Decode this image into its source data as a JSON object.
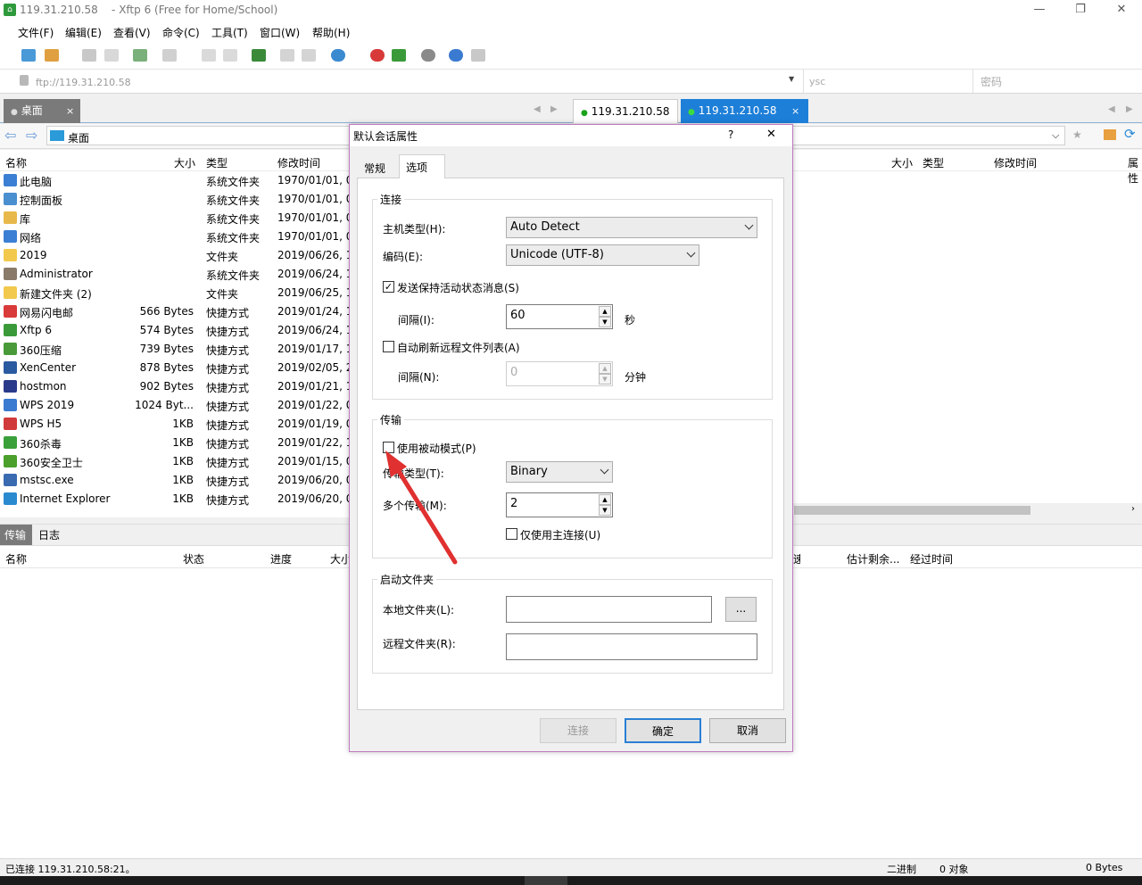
{
  "window": {
    "title": "119.31.210.58    - Xftp 6 (Free for Home/School)",
    "icon": "xftp-app-icon",
    "minimize": "—",
    "restore": "❐",
    "close": "✕"
  },
  "menu": [
    "文件(F)",
    "编辑(E)",
    "查看(V)",
    "命令(C)",
    "工具(T)",
    "窗口(W)",
    "帮助(H)"
  ],
  "address": {
    "url": "ftp://119.31.210.58",
    "username": "ysc",
    "password_placeholder": "密码"
  },
  "tabs": {
    "local": "桌面",
    "local_close": "×",
    "remote1": "119.31.210.58",
    "remote2": "119.31.210.58",
    "remote_close": "×"
  },
  "local_path": "桌面",
  "local_columns": {
    "name": "名称",
    "size": "大小",
    "type": "类型",
    "modified": "修改时间"
  },
  "local_files": [
    {
      "name": "此电脑",
      "size": "",
      "type": "系统文件夹",
      "modified": "1970/01/01, 0",
      "icon": "computer-icon",
      "color": "#3b7fd4"
    },
    {
      "name": "控制面板",
      "size": "",
      "type": "系统文件夹",
      "modified": "1970/01/01, 0",
      "icon": "control-panel-icon",
      "color": "#4a8fd0"
    },
    {
      "name": "库",
      "size": "",
      "type": "系统文件夹",
      "modified": "1970/01/01, 0",
      "icon": "library-icon",
      "color": "#e8b94a"
    },
    {
      "name": "网络",
      "size": "",
      "type": "系统文件夹",
      "modified": "1970/01/01, 0",
      "icon": "network-icon",
      "color": "#3b7fd4"
    },
    {
      "name": "2019",
      "size": "",
      "type": "文件夹",
      "modified": "2019/06/26, 1",
      "icon": "folder-icon",
      "color": "#f2c94c"
    },
    {
      "name": "Administrator",
      "size": "",
      "type": "系统文件夹",
      "modified": "2019/06/24, 1",
      "icon": "user-folder-icon",
      "color": "#8a7a6a"
    },
    {
      "name": "新建文件夹 (2)",
      "size": "",
      "type": "文件夹",
      "modified": "2019/06/25, 1",
      "icon": "folder-icon",
      "color": "#f2c94c"
    },
    {
      "name": "网易闪电邮",
      "size": "566 Bytes",
      "type": "快捷方式",
      "modified": "2019/01/24, 1",
      "icon": "netease-mail-icon",
      "color": "#d93a3a"
    },
    {
      "name": "Xftp 6",
      "size": "574 Bytes",
      "type": "快捷方式",
      "modified": "2019/06/24, 1",
      "icon": "xftp-icon",
      "color": "#3a9a3a"
    },
    {
      "name": "360压缩",
      "size": "739 Bytes",
      "type": "快捷方式",
      "modified": "2019/01/17, 1",
      "icon": "360zip-icon",
      "color": "#4a9a3a"
    },
    {
      "name": "XenCenter",
      "size": "878 Bytes",
      "type": "快捷方式",
      "modified": "2019/02/05, 2",
      "icon": "xencenter-icon",
      "color": "#2a5aa0"
    },
    {
      "name": "hostmon",
      "size": "902 Bytes",
      "type": "快捷方式",
      "modified": "2019/01/21, 1",
      "icon": "hostmon-icon",
      "color": "#2a3a8a"
    },
    {
      "name": "WPS 2019",
      "size": "1024 Byt...",
      "type": "快捷方式",
      "modified": "2019/01/22, 0",
      "icon": "wps-icon",
      "color": "#3a7ad0"
    },
    {
      "name": "WPS H5",
      "size": "1KB",
      "type": "快捷方式",
      "modified": "2019/01/19, 0",
      "icon": "wps-h5-icon",
      "color": "#d03a3a"
    },
    {
      "name": "360杀毒",
      "size": "1KB",
      "type": "快捷方式",
      "modified": "2019/01/22, 1",
      "icon": "360-antivirus-icon",
      "color": "#3aa03a"
    },
    {
      "name": "360安全卫士",
      "size": "1KB",
      "type": "快捷方式",
      "modified": "2019/01/15, 0",
      "icon": "360-safe-icon",
      "color": "#4aa02a"
    },
    {
      "name": "mstsc.exe",
      "size": "1KB",
      "type": "快捷方式",
      "modified": "2019/06/20, 0",
      "icon": "remote-desktop-icon",
      "color": "#3a6ab0"
    },
    {
      "name": "Internet Explorer",
      "size": "1KB",
      "type": "快捷方式",
      "modified": "2019/06/20, 0",
      "icon": "ie-icon",
      "color": "#2a8ad0"
    }
  ],
  "remote_columns": {
    "size": "大小",
    "type": "类型",
    "modified": "修改时间",
    "attr": "属性"
  },
  "bottom_tabs": {
    "transfer": "传输",
    "log": "日志"
  },
  "transfer_columns": {
    "name": "名称",
    "status": "状态",
    "progress": "进度",
    "size": "大小",
    "speed": "速度",
    "eta": "估计剩余...",
    "elapsed": "经过时间"
  },
  "status": {
    "left": "已连接 119.31.210.58:21。",
    "mode": "二进制",
    "objects": "0 对象",
    "bytes": "0 Bytes"
  },
  "dialog": {
    "title": "默认会话属性",
    "help": "?",
    "close": "✕",
    "tabs": [
      "常规",
      "选项"
    ],
    "connection_group": "连接",
    "host_type_label": "主机类型(H):",
    "host_type_value": "Auto Detect",
    "encoding_label": "编码(E):",
    "encoding_value": "Unicode (UTF-8)",
    "keepalive_label": "发送保持活动状态消息(S)",
    "keepalive_checked": "✓",
    "interval_label": "间隔(I):",
    "interval_value": "60",
    "interval_unit": "秒",
    "autorefresh_label": "自动刷新远程文件列表(A)",
    "refresh_interval_label": "间隔(N):",
    "refresh_interval_value": "0",
    "refresh_interval_unit": "分钟",
    "transfer_group": "传输",
    "passive_label": "使用被动模式(P)",
    "transfer_type_label": "传输类型(T):",
    "transfer_type_value": "Binary",
    "multi_transfer_label": "多个传输(M):",
    "multi_transfer_value": "2",
    "primary_only_label": "仅使用主连接(U)",
    "startup_group": "启动文件夹",
    "local_folder_label": "本地文件夹(L):",
    "local_folder_value": "",
    "browse_label": "...",
    "remote_folder_label": "远程文件夹(R):",
    "remote_folder_value": "",
    "connect_button": "连接",
    "ok_button": "确定",
    "cancel_button": "取消"
  },
  "colors": {
    "accent": "#2a7fd4",
    "active_tab": "#1e7fd8",
    "connected": "#1aa31a",
    "dialog_border": "#c07ac0",
    "arrow": "#e03030"
  }
}
